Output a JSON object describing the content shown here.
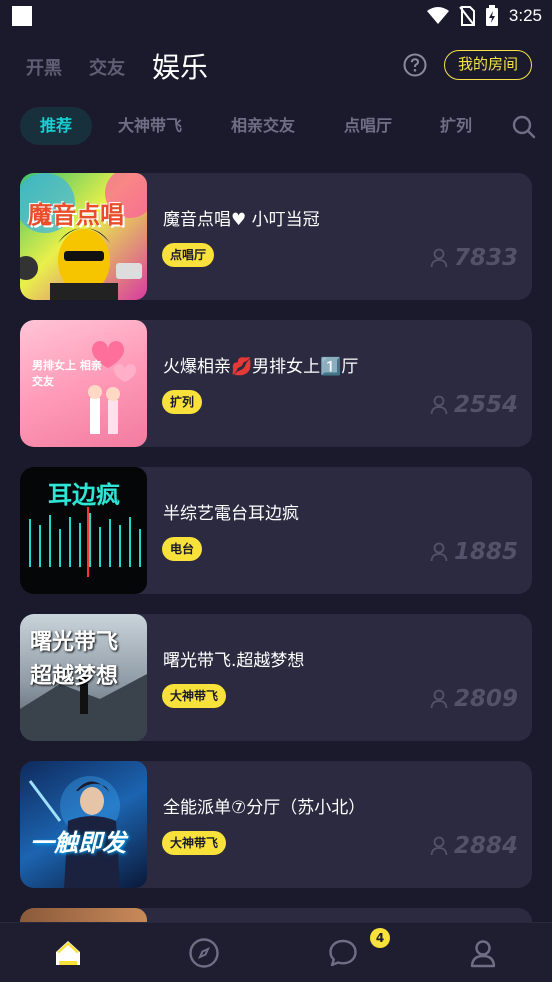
{
  "status": {
    "time": "3:25"
  },
  "top_nav": {
    "tabs": [
      {
        "label": "开黑"
      },
      {
        "label": "交友"
      },
      {
        "label": "娱乐"
      }
    ],
    "my_room_label": "我的房间"
  },
  "category_tabs": [
    {
      "label": "推荐"
    },
    {
      "label": "大神带飞"
    },
    {
      "label": "相亲交友"
    },
    {
      "label": "点唱厅"
    },
    {
      "label": "扩列"
    }
  ],
  "rooms": [
    {
      "title": "魔音点唱♥ 小叮当冠",
      "tag": "点唱厅",
      "count": "7833",
      "thumb_text": "魔音点唱"
    },
    {
      "title": "火爆相亲💋男排女上1️⃣厅",
      "tag": "扩列",
      "count": "2554",
      "thumb_text": "男排女上 相亲交友"
    },
    {
      "title": "半综艺電台耳边疯",
      "tag": "电台",
      "count": "1885",
      "thumb_text": "耳边疯"
    },
    {
      "title": "曙光带飞.超越梦想",
      "tag": "大神带飞",
      "count": "2809",
      "thumb_text": "曙光带飞 超越梦想"
    },
    {
      "title": "全能派单⑦分厅（苏小北）",
      "tag": "大神带飞",
      "count": "2884",
      "thumb_text": "一触即发"
    }
  ],
  "bottom_nav": {
    "badge": "4"
  },
  "colors": {
    "background": "#1b1a2c",
    "card": "#2b2a40",
    "accent_yellow": "#f8e13a",
    "accent_cyan": "#18d0d4"
  }
}
